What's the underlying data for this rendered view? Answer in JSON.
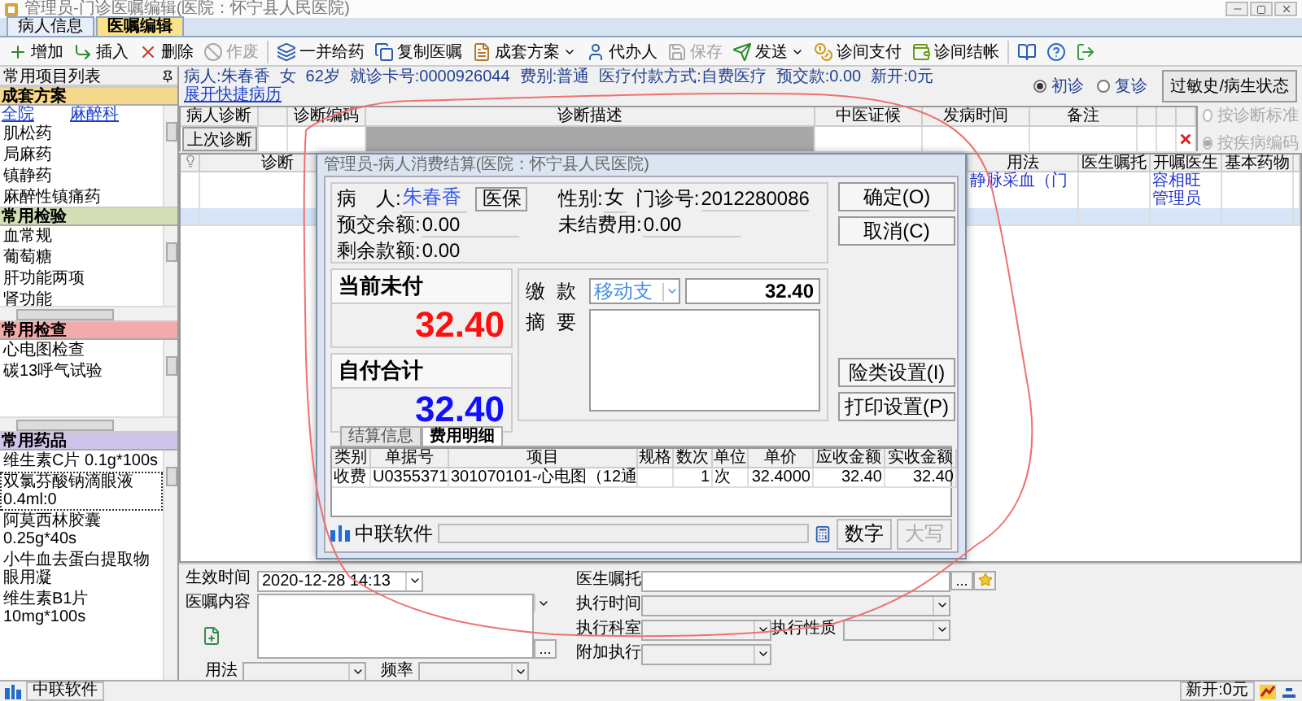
{
  "window": {
    "title": "管理员-门诊医嘱编辑(医院：怀宁县人民医院)"
  },
  "tabs": [
    {
      "label": "病人信息",
      "selected": false
    },
    {
      "label": "医嘱编辑",
      "selected": true
    }
  ],
  "toolbar": [
    {
      "label": "增加",
      "disabled": false,
      "dropdown": false
    },
    {
      "label": "插入",
      "disabled": false,
      "dropdown": false
    },
    {
      "label": "删除",
      "disabled": false,
      "dropdown": false
    },
    {
      "label": "作废",
      "disabled": true,
      "dropdown": false
    },
    {
      "label": "一并给药",
      "disabled": false,
      "dropdown": false
    },
    {
      "label": "复制医嘱",
      "disabled": false,
      "dropdown": false
    },
    {
      "label": "成套方案",
      "disabled": false,
      "dropdown": true
    },
    {
      "label": "代办人",
      "disabled": false,
      "dropdown": false
    },
    {
      "label": "保存",
      "disabled": true,
      "dropdown": false
    },
    {
      "label": "发送",
      "disabled": false,
      "dropdown": true
    },
    {
      "label": "诊间支付",
      "disabled": false,
      "dropdown": false
    },
    {
      "label": "诊间结帐",
      "disabled": false,
      "dropdown": false
    }
  ],
  "sidebar": {
    "title": "常用项目列表",
    "sections": [
      {
        "title": "成套方案",
        "color": "#f7d98b",
        "links": [
          "全院",
          "麻醉科"
        ],
        "items": [
          {
            "label": "肌松药",
            "selected": false
          },
          {
            "label": "局麻药",
            "selected": false
          },
          {
            "label": "镇静药",
            "selected": false
          },
          {
            "label": "麻醉性镇痛药",
            "selected": false
          }
        ]
      },
      {
        "title": "常用检验",
        "color": "#d3dfb5",
        "items": [
          {
            "label": "血常规",
            "selected": false
          },
          {
            "label": "葡萄糖",
            "selected": false
          },
          {
            "label": "肝功能两项",
            "selected": false
          },
          {
            "label": "肾功能",
            "selected": false
          }
        ]
      },
      {
        "title": "常用检查",
        "color": "#f2aaaa",
        "items": [
          {
            "label": "心电图检查",
            "selected": false
          },
          {
            "label": "碳13呼气试验",
            "selected": false
          }
        ]
      },
      {
        "title": "常用药品",
        "color": "#cfc3ea",
        "items": [
          {
            "label": "维生素C片 0.1g*100s",
            "selected": false
          },
          {
            "label": "双氯芬酸钠滴眼液 0.4ml:0",
            "selected": true
          },
          {
            "label": "阿莫西林胶囊 0.25g*40s",
            "selected": false
          },
          {
            "label": "小牛血去蛋白提取物眼用凝",
            "selected": false
          },
          {
            "label": "维生素B1片 10mg*100s",
            "selected": false
          }
        ]
      }
    ]
  },
  "patient_bar": {
    "fields": [
      "病人:朱春香",
      "女",
      "62岁",
      "就诊卡号:0000926044",
      "费别:普通",
      "医疗付款方式:自费医疗",
      "预交款:0.00",
      "新开:0元"
    ],
    "link": "展开快捷病历",
    "visit_types": [
      {
        "label": "初诊",
        "selected": true
      },
      {
        "label": "复诊",
        "selected": false
      }
    ],
    "history_button": "过敏史/病生状态"
  },
  "diagnosis": {
    "columns": [
      "病人诊断",
      "诊断编码",
      "诊断描述",
      "中医证候",
      "发病时间",
      "备注"
    ],
    "last_button": "上次诊断",
    "modes": [
      {
        "label": "按诊断标准",
        "selected": false,
        "disabled": true
      },
      {
        "label": "按疾病编码",
        "selected": true,
        "disabled": true
      }
    ]
  },
  "orders": {
    "columns": [
      "诊断",
      "用法",
      "医生嘱托",
      "开嘱医生",
      "基本药物"
    ],
    "rows": [
      {
        "usage": "静脉采血（门",
        "doctor": "容相旺",
        "selected": false
      },
      {
        "doctor": "管理员",
        "selected": false
      },
      {
        "selected": true
      }
    ]
  },
  "dialog": {
    "title": "管理员-病人消费结算(医院：怀宁县人民医院)",
    "patient": {
      "label": "病　人:",
      "value": "朱春香",
      "button": "医保"
    },
    "gender": {
      "label": "性别:",
      "value": "女"
    },
    "visit_no": {
      "label": "门诊号:",
      "value": "2012280086"
    },
    "balances": [
      {
        "label": "预交余额:",
        "value": "0.00"
      },
      {
        "label": "未结费用:",
        "value": "0.00"
      },
      {
        "label": "剩余款额:",
        "value": "0.00"
      }
    ],
    "amounts": [
      {
        "label": "当前未付",
        "value": "32.40",
        "kind": "due"
      },
      {
        "label": "自付合计",
        "value": "32.40",
        "kind": "total"
      }
    ],
    "payment": {
      "label": "缴款",
      "method": "移动支",
      "amount": "32.40",
      "memo_label": "摘要"
    },
    "buttons": [
      "确定(O)",
      "取消(C)",
      "险类设置(I)",
      "打印设置(P)"
    ],
    "tabs": [
      {
        "label": "结算信息",
        "selected": false
      },
      {
        "label": "费用明细",
        "selected": true
      }
    ],
    "table": {
      "columns": [
        "类别",
        "单据号",
        "项目",
        "规格",
        "数次",
        "单位",
        "单价",
        "应收金额",
        "实收金额"
      ],
      "rows": [
        {
          "category": "收费",
          "receipt": "U0355371",
          "item": "301070101-心电图（12通",
          "count": "1",
          "unit": "次",
          "price": "32.4000",
          "due": "32.40",
          "paid": "32.40"
        }
      ]
    },
    "status": {
      "brand": "中联软件",
      "modes": [
        {
          "label": "数字",
          "disabled": false
        },
        {
          "label": "大写",
          "disabled": true
        }
      ]
    }
  },
  "form": {
    "effective": {
      "label": "生效时间",
      "value": "2020-12-28 14:13"
    },
    "content": {
      "label": "医嘱内容",
      "more": "..."
    },
    "usage": {
      "label": "用法",
      "disabled": true
    },
    "frequency": {
      "label": "频率",
      "disabled": true
    },
    "fields": [
      {
        "label": "医生嘱托",
        "disabled": false,
        "more": "..."
      },
      {
        "label": "执行时间",
        "disabled": true
      },
      {
        "label": "执行科室",
        "disabled": true
      },
      {
        "label": "执行性质",
        "disabled": true
      },
      {
        "label": "附加执行",
        "disabled": true
      }
    ]
  },
  "status_bar": {
    "brand": "中联软件",
    "new_fee": "新开:0元"
  }
}
